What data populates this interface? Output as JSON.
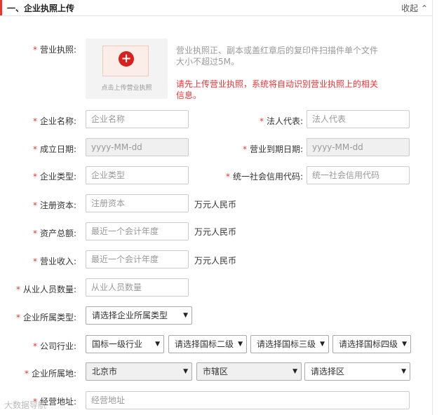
{
  "section": {
    "title": "一、企业执照上传",
    "collapse_label": "收起",
    "collapse_icon": "chevron-up"
  },
  "license": {
    "label": "营业执照:",
    "upload_text": "点击上传营业执照",
    "tip": "营业执照正、副本或盖红章后的复印件扫描件单个文件大小不超过5M。",
    "warning": "请先上传营业执照，系统将自动识别营业执照上的相关信息。"
  },
  "fields": {
    "company_name": {
      "label": "企业名称:",
      "placeholder": "企业名称"
    },
    "legal_rep": {
      "label": "法人代表:",
      "placeholder": "法人代表"
    },
    "found_date": {
      "label": "成立日期:",
      "placeholder": "yyyy-MM-dd"
    },
    "expire_date": {
      "label": "营业到期日期:",
      "placeholder": "yyyy-MM-dd"
    },
    "company_type": {
      "label": "企业类型:",
      "placeholder": "企业类型"
    },
    "credit_code": {
      "label": "统一社会信用代码:",
      "placeholder": "统一社会信用代码"
    },
    "reg_capital": {
      "label": "注册资本:",
      "placeholder": "注册资本",
      "unit": "万元人民币"
    },
    "total_assets": {
      "label": "资产总额:",
      "placeholder": "最近一个会计年度",
      "unit": "万元人民币"
    },
    "revenue": {
      "label": "营业收入:",
      "placeholder": "最近一个会计年度",
      "unit": "万元人民币"
    },
    "employees": {
      "label": "从业人员数量:",
      "placeholder": "从业人员数量"
    },
    "enterprise_category": {
      "label": "企业所属类型:",
      "selected": "请选择企业所属类型"
    },
    "industry": {
      "label": "公司行业:",
      "level1": "国标一级行业",
      "level2": "请选择国标二级",
      "level3": "请选择国标三级",
      "level4": "请选择国标四级"
    },
    "location": {
      "label": "企业所属地:",
      "province": "北京市",
      "city": "市辖区",
      "district": "请选择区"
    },
    "address": {
      "label": "经营地址:",
      "placeholder": "经营地址"
    }
  },
  "watermark": "大数据导航"
}
